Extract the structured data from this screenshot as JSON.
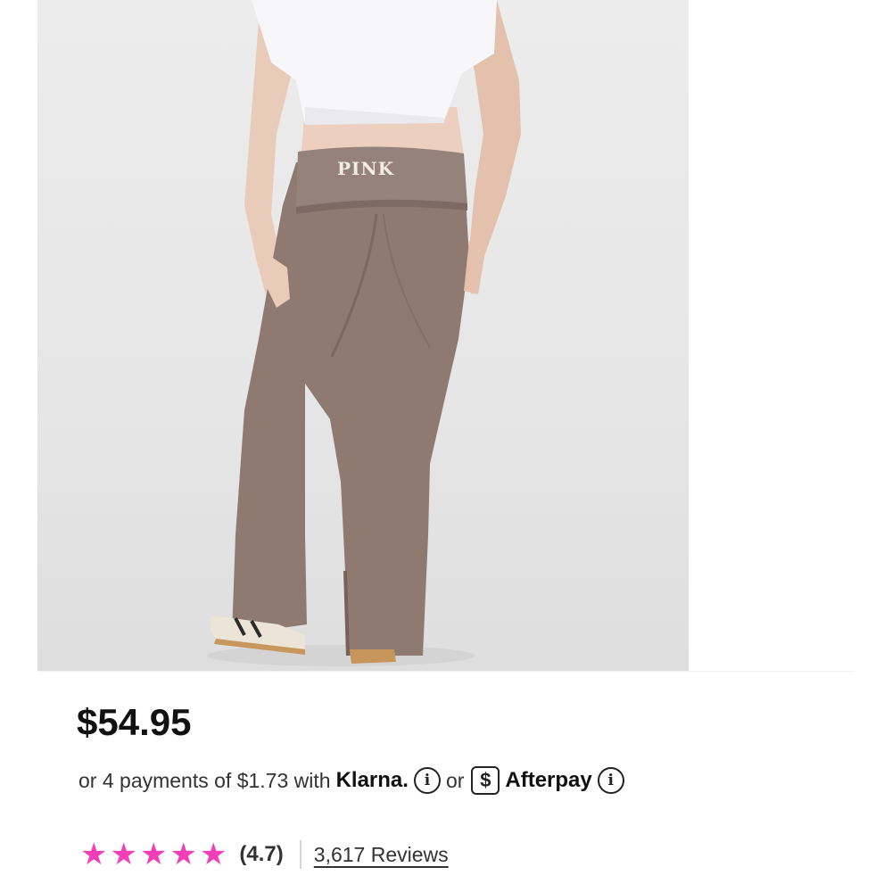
{
  "product": {
    "image_brand_text": "PINK",
    "price": "$54.95"
  },
  "payments": {
    "prefix": "or 4 payments of $1.73 with",
    "klarna_label": "Klarna.",
    "or_text": "or",
    "afterpay_label": "Afterpay",
    "info_glyph": "i",
    "cash_glyph": "$"
  },
  "rating": {
    "stars": 5,
    "star_glyph": "★",
    "value": "(4.7)",
    "reviews": "3,617 Reviews"
  },
  "colors": {
    "star": "#f23fb8",
    "pants": "#8e7a71",
    "background": "#e8e8e8"
  },
  "icons": [
    "info-icon",
    "cash-app-icon",
    "star-icon"
  ]
}
